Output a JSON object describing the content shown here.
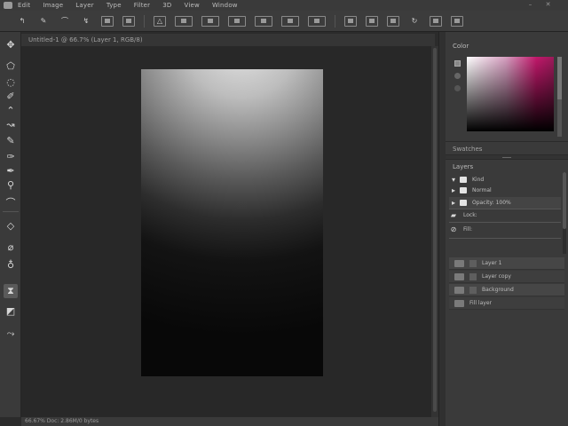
{
  "menubar": {
    "items": [
      "Edit",
      "Image",
      "Layer",
      "Type",
      "Filter",
      "3D",
      "View",
      "Window"
    ]
  },
  "document": {
    "tab_label": "Untitled-1 @ 66.7% (Layer 1, RGB/8)"
  },
  "status": {
    "text": "66.67%   Doc: 2.86M/0 bytes"
  },
  "color_panel": {
    "title": "Color"
  },
  "swatches_panel": {
    "label": "Swatches"
  },
  "layers_panel": {
    "title": "Layers",
    "rows": [
      "Kind",
      "Normal",
      "Opacity: 100%",
      "Lock:",
      "Fill:"
    ],
    "properties": [
      "Layer 1",
      "Layer copy",
      "Background",
      "Fill layer"
    ]
  },
  "colors": {
    "accent_magenta": "#c2186b",
    "ui_bg": "#3a3a3a"
  }
}
